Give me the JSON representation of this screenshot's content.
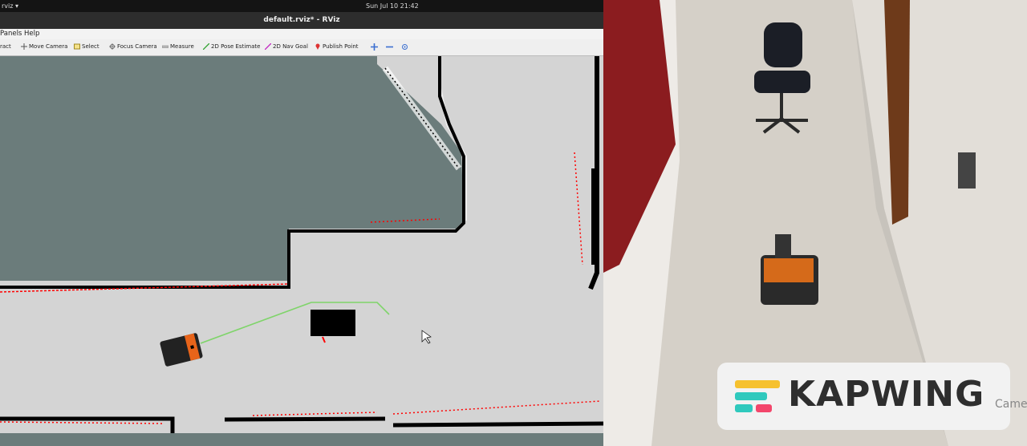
{
  "topbar": {
    "app": "rviz ▾",
    "clock": "Sun Jul 10  21:42"
  },
  "window": {
    "title": "default.rviz* - RViz"
  },
  "menu": {
    "panels": "Panels",
    "help": "Help"
  },
  "toolbar": {
    "interact": "ract",
    "move_camera": "Move Camera",
    "select": "Select",
    "focus_camera": "Focus Camera",
    "measure": "Measure",
    "pose_estimate": "2D Pose Estimate",
    "nav_goal": "2D Nav Goal",
    "publish_point": "Publish Point"
  },
  "colors": {
    "free_space": "#d4d4d4",
    "unknown": "#6b7c7b",
    "obstacle": "#000000",
    "laser": "#ff0000",
    "path": "#7fd46a",
    "robot": "#e8641a",
    "kapwing_teal": "#2fc9bd",
    "kapwing_yellow": "#f6c12e",
    "kapwing_pink": "#f3466b"
  },
  "overlay": {
    "brand": "KAPWING",
    "camera_label": "Came"
  }
}
